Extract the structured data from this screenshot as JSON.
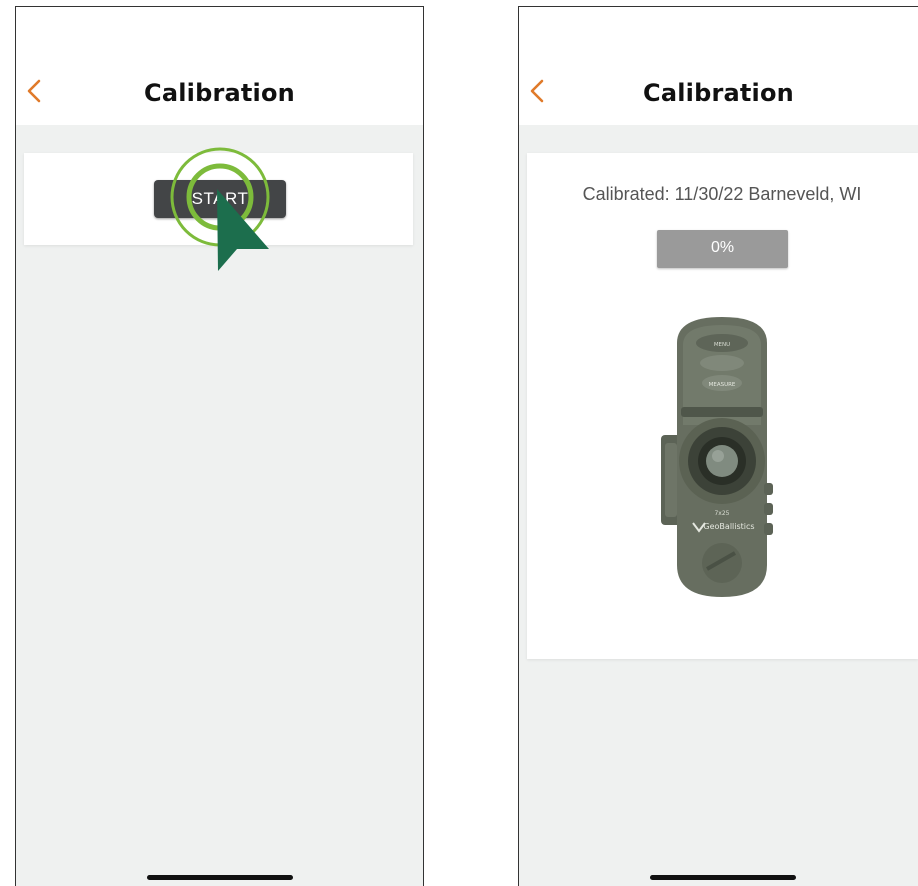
{
  "left_screen": {
    "header": {
      "title": "Calibration",
      "back_icon": "chevron-left-icon"
    },
    "card": {
      "start_label": "START"
    },
    "overlay": {
      "icon": "tap-cursor-icon"
    }
  },
  "right_screen": {
    "header": {
      "title": "Calibration",
      "back_icon": "chevron-left-icon"
    },
    "card": {
      "calibrated_text": "Calibrated: 11/30/22 Barneveld, WI",
      "progress_label": "0%",
      "progress_value": 0
    },
    "device_image": {
      "icon": "rangefinder-image",
      "text_marks": [
        "MENU",
        "MEASURE",
        "7x25",
        "GeoBallistics"
      ]
    }
  },
  "colors": {
    "accent": "#e07a2a",
    "cursor": "#1c6e4d",
    "tap_ring": "#7dbb3b",
    "button": "#434547",
    "screen_bg": "#eff1f0"
  }
}
